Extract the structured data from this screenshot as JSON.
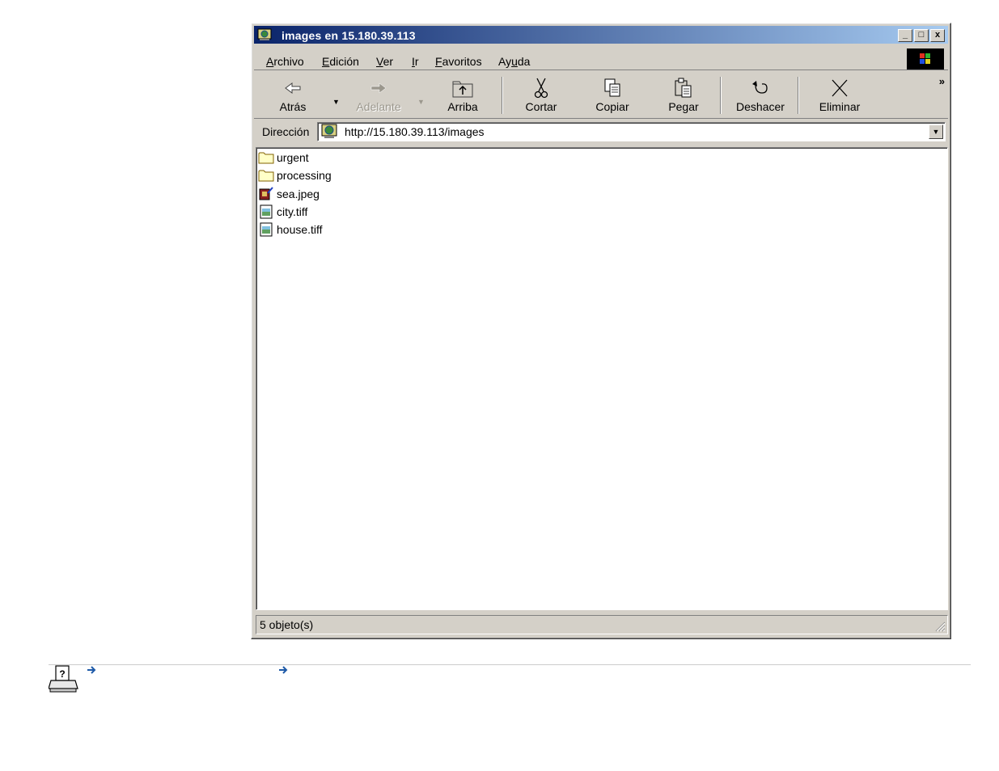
{
  "window": {
    "title": "images en 15.180.39.113",
    "controls": {
      "minimize": "_",
      "maximize": "□",
      "close": "x"
    }
  },
  "menu": [
    {
      "label": "Archivo",
      "accel_index": 0
    },
    {
      "label": "Edición",
      "accel_index": 0
    },
    {
      "label": "Ver",
      "accel_index": 0
    },
    {
      "label": "Ir",
      "accel_index": 0
    },
    {
      "label": "Favoritos",
      "accel_index": 0
    },
    {
      "label": "Ayuda",
      "accel_index": 2
    }
  ],
  "toolbar": {
    "back": "Atrás",
    "forward": "Adelante",
    "up": "Arriba",
    "cut": "Cortar",
    "copy": "Copiar",
    "paste": "Pegar",
    "undo": "Deshacer",
    "delete": "Eliminar",
    "more": "»"
  },
  "address": {
    "label": "Dirección",
    "url": "http://15.180.39.113/images"
  },
  "files": [
    {
      "name": "urgent",
      "icon": "folder-icon"
    },
    {
      "name": "processing",
      "icon": "folder-icon"
    },
    {
      "name": "sea.jpeg",
      "icon": "jpeg-file-icon"
    },
    {
      "name": "city.tiff",
      "icon": "image-file-icon"
    },
    {
      "name": "house.tiff",
      "icon": "image-file-icon"
    }
  ],
  "status": {
    "text": "5 objeto(s)"
  },
  "footer": {
    "icons": [
      "print-help-icon",
      "arrow-right-icon",
      "arrow-right-icon"
    ]
  },
  "colors": {
    "titlebar_start": "#0a246a",
    "titlebar_end": "#a6caf0",
    "chrome": "#d4d0c8",
    "link_arrow": "#1e5aa8"
  }
}
